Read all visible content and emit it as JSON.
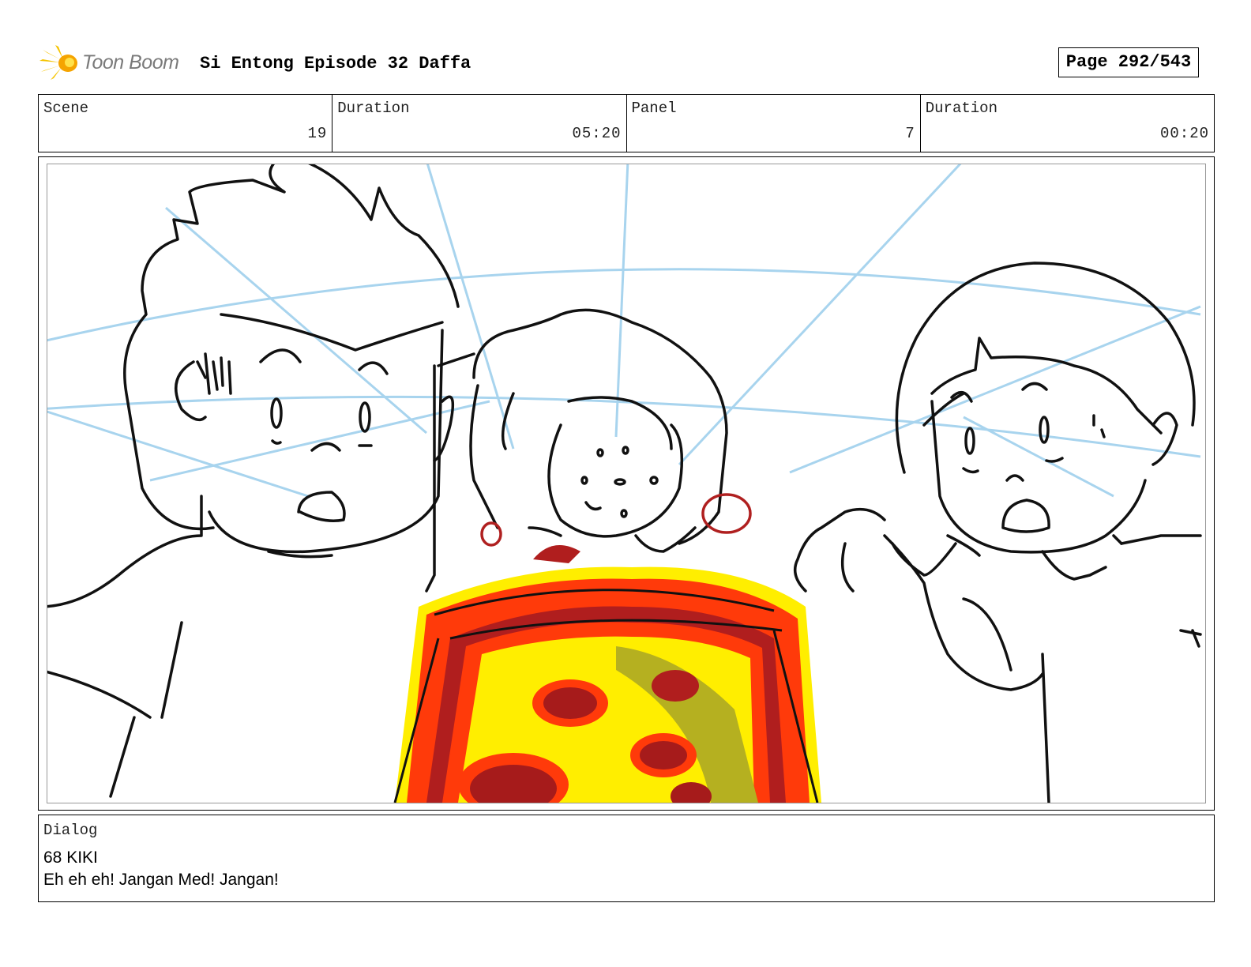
{
  "header": {
    "logo_text": "Toon Boom",
    "title": "Si Entong Episode 32 Daffa",
    "page_label": "Page 292/543"
  },
  "info": {
    "scene_label": "Scene",
    "scene_value": "19",
    "scene_duration_label": "Duration",
    "scene_duration_value": "05:20",
    "panel_label": "Panel",
    "panel_value": "7",
    "panel_duration_label": "Duration",
    "panel_duration_value": "00:20"
  },
  "dialog": {
    "label": "Dialog",
    "line1": "68 KIKI",
    "line2": "Eh eh eh! Jangan Med! Jangan!"
  }
}
